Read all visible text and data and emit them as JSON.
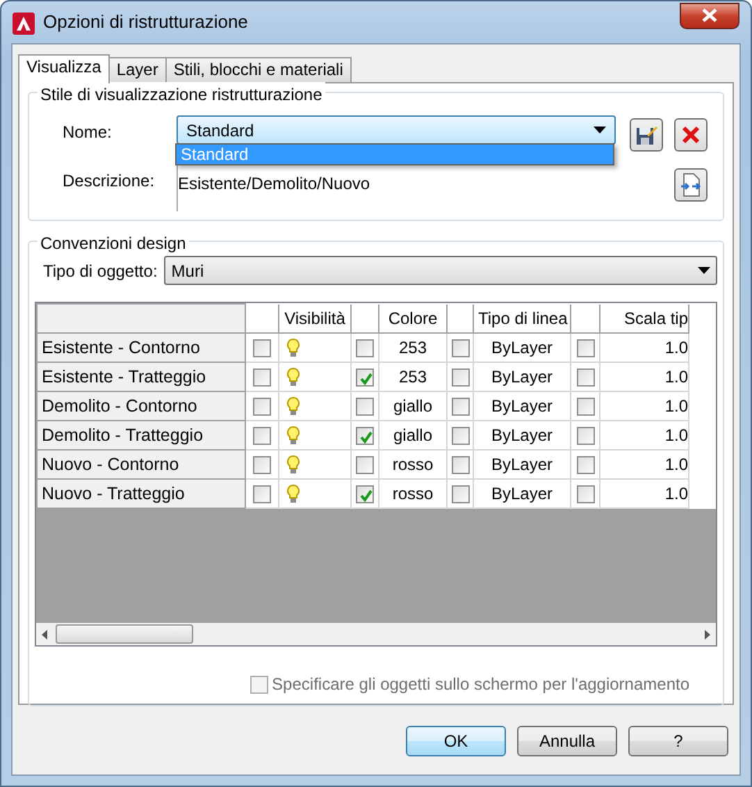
{
  "window": {
    "title": "Opzioni di ristrutturazione"
  },
  "tabs": [
    {
      "label": "Visualizza",
      "selected": true
    },
    {
      "label": "Layer",
      "selected": false
    },
    {
      "label": "Stili, blocchi e materiali",
      "selected": false
    }
  ],
  "style_group": {
    "title": "Stile di visualizzazione ristrutturazione",
    "name_label": "Nome:",
    "name_value": "Standard",
    "dropdown_options": [
      {
        "label": "Standard",
        "selected": true
      }
    ],
    "description_label": "Descrizione:",
    "description_lines": [
      "Esistente/Demolito/Nuovo"
    ]
  },
  "design_group": {
    "title": "Convenzioni design",
    "object_type_label": "Tipo di oggetto:",
    "object_type_value": "Muri",
    "table": {
      "columns": [
        "Visibilità",
        "Colore",
        "Tipo di linea",
        "Scala tip"
      ],
      "rows": [
        {
          "name": "Esistente - Contorno",
          "override_visibility": false,
          "visible": true,
          "override_color": false,
          "colour_value": "253",
          "override_linetype": false,
          "linetype": "ByLayer",
          "override_scale": false,
          "scale": "1.0"
        },
        {
          "name": "Esistente - Tratteggio",
          "override_visibility": false,
          "visible": true,
          "override_color": true,
          "colour_value": "253",
          "override_linetype": false,
          "linetype": "ByLayer",
          "override_scale": false,
          "scale": "1.0"
        },
        {
          "name": "Demolito - Contorno",
          "override_visibility": false,
          "visible": true,
          "override_color": false,
          "colour_value": "giallo",
          "override_linetype": false,
          "linetype": "ByLayer",
          "override_scale": false,
          "scale": "1.0"
        },
        {
          "name": "Demolito - Tratteggio",
          "override_visibility": false,
          "visible": true,
          "override_color": true,
          "colour_value": "giallo",
          "override_linetype": false,
          "linetype": "ByLayer",
          "override_scale": false,
          "scale": "1.0"
        },
        {
          "name": "Nuovo - Contorno",
          "override_visibility": false,
          "visible": true,
          "override_color": false,
          "colour_value": "rosso",
          "override_linetype": false,
          "linetype": "ByLayer",
          "override_scale": false,
          "scale": "1.0"
        },
        {
          "name": "Nuovo - Tratteggio",
          "override_visibility": false,
          "visible": true,
          "override_color": true,
          "colour_value": "rosso",
          "override_linetype": false,
          "linetype": "ByLayer",
          "override_scale": false,
          "scale": "1.0"
        }
      ]
    }
  },
  "update_checkbox": {
    "label": "Specificare gli oggetti sullo schermo per l'aggiornamento",
    "checked": false,
    "disabled": true
  },
  "buttons": [
    {
      "label": "OK",
      "default": true
    },
    {
      "label": "Annulla",
      "default": false
    },
    {
      "label": "?",
      "default": false
    }
  ]
}
